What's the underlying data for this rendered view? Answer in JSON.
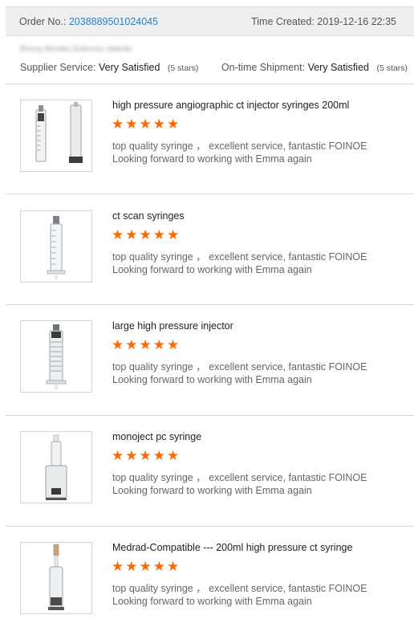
{
  "order": {
    "order_no_label": "Order No.:",
    "order_no": "2038889501024045",
    "time_label": "Time Created:",
    "time_created": "2019-12-16 22:35"
  },
  "buyer": {
    "name": "Ronny Broeks,Solomon Islands"
  },
  "ratings": {
    "supplier_label": "Supplier Service:",
    "supplier_value": "Very Satisfied",
    "supplier_stars": "(5 stars)",
    "shipment_label": "On-time Shipment:",
    "shipment_value": "Very Satisfied",
    "shipment_stars": "(5 stars)"
  },
  "colors": {
    "accent_link": "#2d7fc1",
    "star": "#ff6a00"
  },
  "products": [
    {
      "title": "high pressure angiographic ct injector syringes 200ml",
      "rating": 5,
      "review_line1": "top quality syringe ， excellent service, fantastic FOINOE",
      "review_line2": "Looking forward to working with Emma again",
      "image_icon": "syringe-pair-image"
    },
    {
      "title": "ct scan syringes",
      "rating": 5,
      "review_line1": "top quality syringe ， excellent service, fantastic FOINOE",
      "review_line2": "Looking forward to working with Emma again",
      "image_icon": "syringe-image"
    },
    {
      "title": "large high pressure injector",
      "rating": 5,
      "review_line1": "top quality syringe ， excellent service, fantastic FOINOE",
      "review_line2": "Looking forward to working with Emma again",
      "image_icon": "syringe-image"
    },
    {
      "title": "monoject pc syringe",
      "rating": 5,
      "review_line1": "top quality syringe ， excellent service, fantastic FOINOE",
      "review_line2": "Looking forward to working with Emma again",
      "image_icon": "syringe-image"
    },
    {
      "title": "Medrad-Compatible --- 200ml high pressure ct syringe",
      "rating": 5,
      "review_line1": "top quality syringe ， excellent service, fantastic FOINOE",
      "review_line2": "Looking forward to working with Emma again",
      "image_icon": "syringe-image"
    }
  ]
}
